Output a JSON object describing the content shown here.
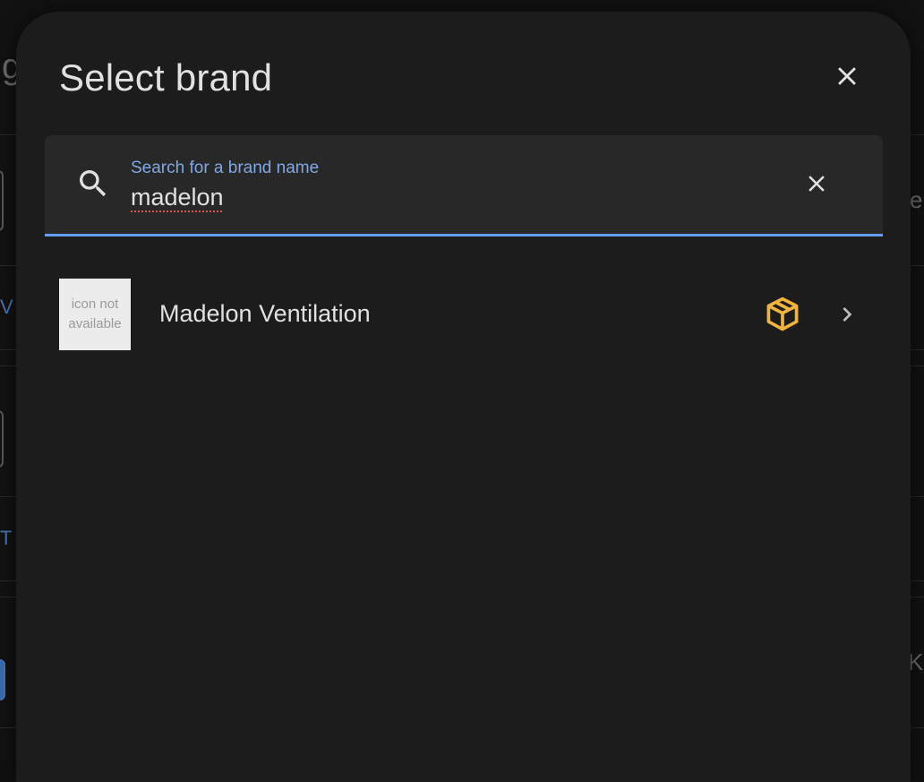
{
  "dialog": {
    "title": "Select brand",
    "close_icon": "close-icon"
  },
  "search": {
    "label": "Search for a brand name",
    "value": "madelon",
    "search_icon": "search-icon",
    "clear_icon": "clear-icon"
  },
  "results": [
    {
      "logo_text": "icon not available",
      "name": "Madelon Ventilation",
      "badge_icon": "custom-integration-icon",
      "chevron_icon": "chevron-right-icon"
    }
  ],
  "background_fragments": {
    "top_left": "g",
    "row1_right": "e",
    "row2_left": "V",
    "row4_left": "T",
    "row5_right": "Ki"
  },
  "colors": {
    "accent": "#669df6",
    "label": "#7ea8e6",
    "badge": "#f0b43c",
    "dialog_bg": "#1c1c1c"
  }
}
